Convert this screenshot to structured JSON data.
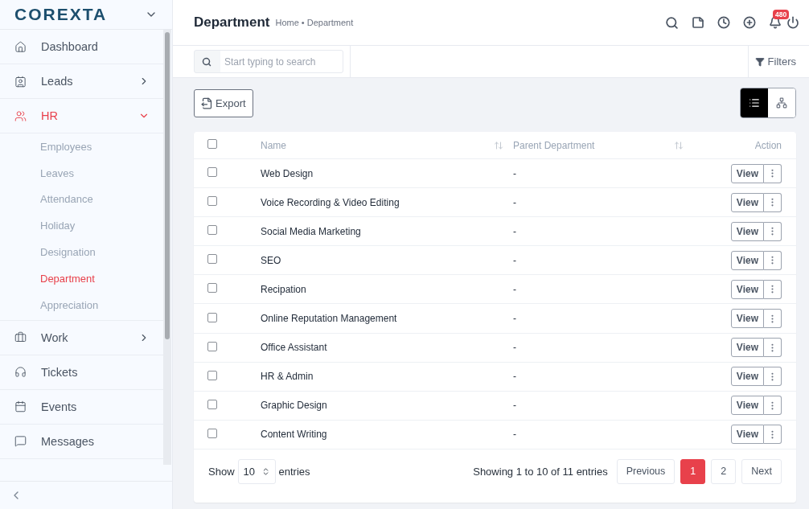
{
  "sidebar": {
    "logo": "COREXTA",
    "items": [
      {
        "label": "Dashboard",
        "selected": false
      },
      {
        "label": "Leads",
        "selected": false,
        "expanded": false
      },
      {
        "label": "HR",
        "selected": true,
        "expanded": true,
        "children": [
          {
            "label": "Employees",
            "selected": false
          },
          {
            "label": "Leaves",
            "selected": false
          },
          {
            "label": "Attendance",
            "selected": false
          },
          {
            "label": "Holiday",
            "selected": false
          },
          {
            "label": "Designation",
            "selected": false
          },
          {
            "label": "Department",
            "selected": true
          },
          {
            "label": "Appreciation",
            "selected": false
          }
        ]
      },
      {
        "label": "Work",
        "selected": false,
        "expanded": false
      },
      {
        "label": "Tickets",
        "selected": false
      },
      {
        "label": "Events",
        "selected": false
      },
      {
        "label": "Messages",
        "selected": false
      }
    ]
  },
  "header": {
    "title": "Department",
    "breadcrumb": "Home • Department",
    "notification_count": "480"
  },
  "search": {
    "placeholder": "Start typing to search"
  },
  "filters": "Filters",
  "export": "Export",
  "views": [
    {
      "selected": true
    },
    {
      "selected": false
    }
  ],
  "table": {
    "header_checked": false,
    "columns": [
      "Name",
      "Parent Department",
      "Action"
    ],
    "rows": [
      {
        "checked": false,
        "name": "Web Design",
        "parent": "-",
        "action": "View"
      },
      {
        "checked": false,
        "name": "Voice Recording & Video Editing",
        "parent": "-",
        "action": "View"
      },
      {
        "checked": false,
        "name": "Social Media Marketing",
        "parent": "-",
        "action": "View"
      },
      {
        "checked": false,
        "name": "SEO",
        "parent": "-",
        "action": "View"
      },
      {
        "checked": false,
        "name": "Recipation",
        "parent": "-",
        "action": "View"
      },
      {
        "checked": false,
        "name": "Online Reputation Management",
        "parent": "-",
        "action": "View"
      },
      {
        "checked": false,
        "name": "Office Assistant",
        "parent": "-",
        "action": "View"
      },
      {
        "checked": false,
        "name": "HR & Admin",
        "parent": "-",
        "action": "View"
      },
      {
        "checked": false,
        "name": "Graphic Design",
        "parent": "-",
        "action": "View"
      },
      {
        "checked": false,
        "name": "Content Writing",
        "parent": "-",
        "action": "View"
      }
    ]
  },
  "footer": {
    "show_label": "Show",
    "page_size": "10",
    "entries_label": "entries",
    "info": "Showing 1 to 10 of 11 entries",
    "pages": [
      {
        "label": "Previous",
        "selected": false
      },
      {
        "label": "1",
        "selected": true
      },
      {
        "label": "2",
        "selected": false
      },
      {
        "label": "Next",
        "selected": false
      }
    ]
  }
}
